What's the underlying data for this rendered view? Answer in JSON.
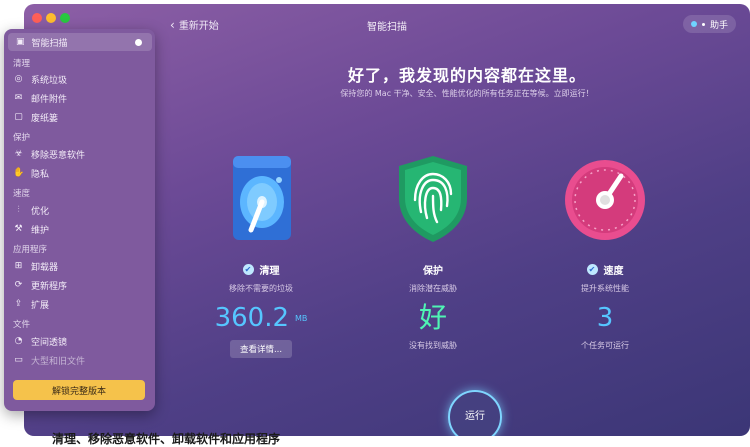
{
  "window": {
    "title": "智能扫描",
    "back_label": "重新开始",
    "assistant_label": "助手"
  },
  "sidebar": {
    "active_item": "智能扫描",
    "sections": [
      {
        "title": "清理",
        "items": [
          "系统垃圾",
          "邮件附件",
          "废纸篓"
        ]
      },
      {
        "title": "保护",
        "items": [
          "移除恶意软件",
          "隐私"
        ]
      },
      {
        "title": "速度",
        "items": [
          "优化",
          "维护"
        ]
      },
      {
        "title": "应用程序",
        "items": [
          "卸载器",
          "更新程序",
          "扩展"
        ]
      },
      {
        "title": "文件",
        "items": [
          "空间透镜",
          "大型和旧文件"
        ]
      }
    ],
    "unlock_label": "解锁完整版本"
  },
  "main": {
    "headline": "好了，我发现的内容都在这里。",
    "subline": "保持您的 Mac 干净、安全、性能优化的所有任务正在等候。立即运行！",
    "cards": [
      {
        "title": "清理",
        "desc": "移除不需要的垃圾",
        "value": "360.2",
        "unit": "MB",
        "button": "查看详情..."
      },
      {
        "title": "保护",
        "desc": "消除潜在威胁",
        "value": "好",
        "foot": "没有找到威胁"
      },
      {
        "title": "速度",
        "desc": "提升系统性能",
        "value": "3",
        "foot": "个任务可运行"
      }
    ],
    "run_label": "运行"
  },
  "caption": "清理、移除恶意软件、卸载软件和应用程序",
  "colors": {
    "accent_blue": "#56c6ff",
    "accent_green": "#4ff5b4",
    "unlock_yellow": "#f5c24b"
  },
  "icons": [
    "back-chevron-icon",
    "scan-icon",
    "trash-icon",
    "mail-icon",
    "bin-icon",
    "biohazard-icon",
    "hand-icon",
    "sliders-icon",
    "wrench-icon",
    "uninstaller-icon",
    "update-icon",
    "extension-icon",
    "lens-icon",
    "folder-icon",
    "hard-drive-icon",
    "shield-fingerprint-icon",
    "speedometer-icon"
  ]
}
